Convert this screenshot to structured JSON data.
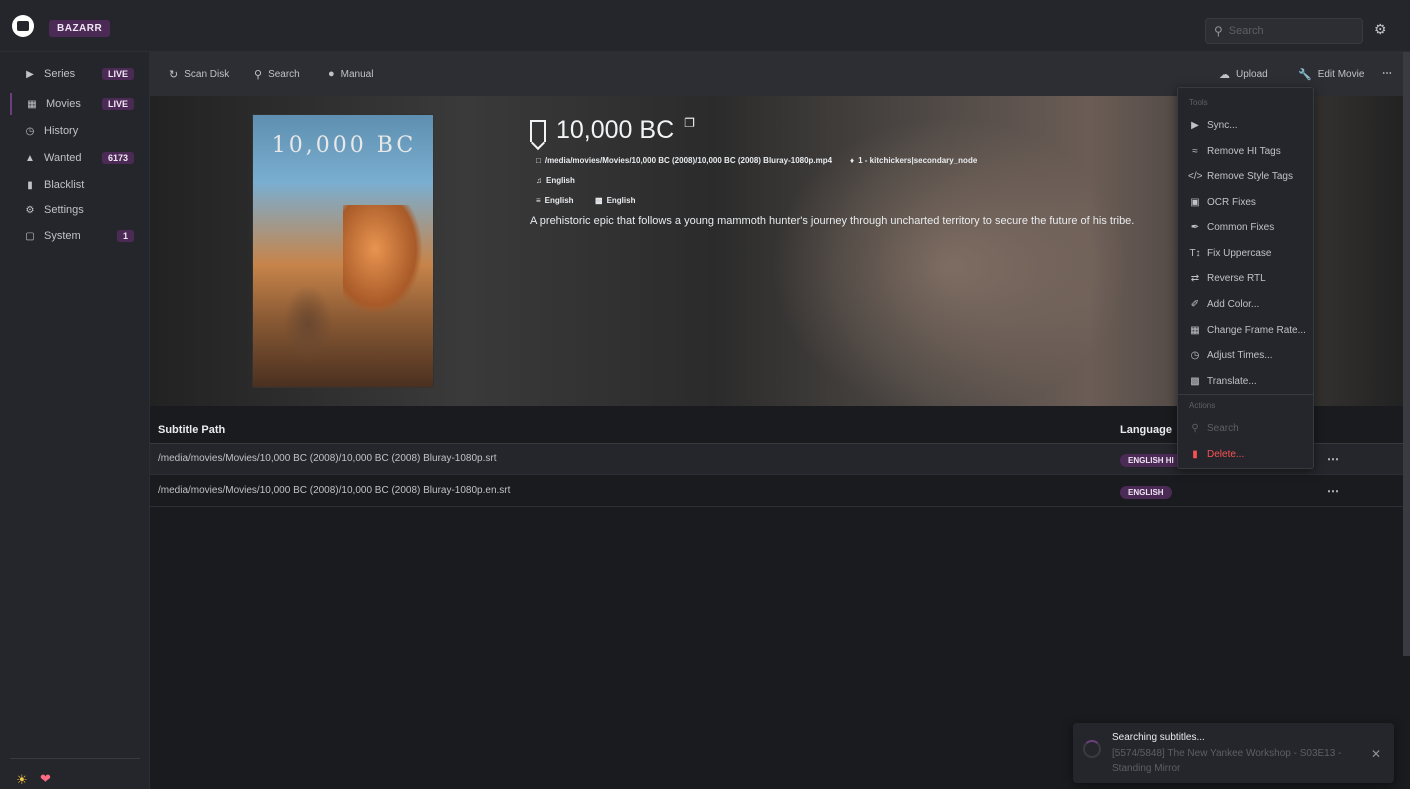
{
  "header": {
    "brand": "BAZARR",
    "search_placeholder": "Search"
  },
  "sidebar": {
    "items": [
      {
        "label": "Series",
        "icon": "play-icon",
        "badge": "LIVE"
      },
      {
        "label": "Movies",
        "icon": "film-icon",
        "badge": "LIVE"
      },
      {
        "label": "History",
        "icon": "clock-icon",
        "badge": ""
      },
      {
        "label": "Wanted",
        "icon": "warning-icon",
        "badge": "6173"
      },
      {
        "label": "Blacklist",
        "icon": "file-icon",
        "badge": ""
      },
      {
        "label": "Settings",
        "icon": "gears-icon",
        "badge": ""
      },
      {
        "label": "System",
        "icon": "laptop-icon",
        "badge": "1"
      }
    ]
  },
  "toolbar": {
    "scan_disk": "Scan Disk",
    "search": "Search",
    "manual": "Manual",
    "upload": "Upload",
    "edit_movie": "Edit Movie"
  },
  "movie": {
    "title": "10,000 BC",
    "poster_text": "10,000 BC",
    "path": "/media/movies/Movies/10,000 BC (2008)/10,000 BC (2008) Bluray-1080p.mp4",
    "tag": "1 - kitchickers|secondary_node",
    "audio": "English",
    "language_1": "English",
    "language_2": "English",
    "overview": "A prehistoric epic that follows a young mammoth hunter's journey through uncharted territory to secure the future of his tribe."
  },
  "table": {
    "col_path": "Subtitle Path",
    "col_language": "Language",
    "rows": [
      {
        "path": "/media/movies/Movies/10,000 BC (2008)/10,000 BC (2008) Bluray-1080p.srt",
        "language": "ENGLISH HI"
      },
      {
        "path": "/media/movies/Movies/10,000 BC (2008)/10,000 BC (2008) Bluray-1080p.en.srt",
        "language": "ENGLISH"
      }
    ]
  },
  "menu": {
    "tools_label": "Tools",
    "items": [
      {
        "label": "Sync...",
        "icon": "play-icon"
      },
      {
        "label": "Remove HI Tags",
        "icon": "deaf-icon"
      },
      {
        "label": "Remove Style Tags",
        "icon": "code-icon"
      },
      {
        "label": "OCR Fixes",
        "icon": "image-icon"
      },
      {
        "label": "Common Fixes",
        "icon": "magic-icon"
      },
      {
        "label": "Fix Uppercase",
        "icon": "text-height-icon"
      },
      {
        "label": "Reverse RTL",
        "icon": "exchange-icon"
      },
      {
        "label": "Add Color...",
        "icon": "paint-brush-icon"
      },
      {
        "label": "Change Frame Rate...",
        "icon": "film-icon"
      },
      {
        "label": "Adjust Times...",
        "icon": "clock-icon"
      },
      {
        "label": "Translate...",
        "icon": "language-icon"
      }
    ],
    "actions_label": "Actions",
    "search": "Search",
    "delete": "Delete..."
  },
  "toast": {
    "title": "Searching subtitles...",
    "message": "[5574/5848] The New Yankee Workshop - S03E13 - Standing Mirror"
  },
  "colors": {
    "accent": "#4b2a55",
    "danger": "#fa5252"
  }
}
